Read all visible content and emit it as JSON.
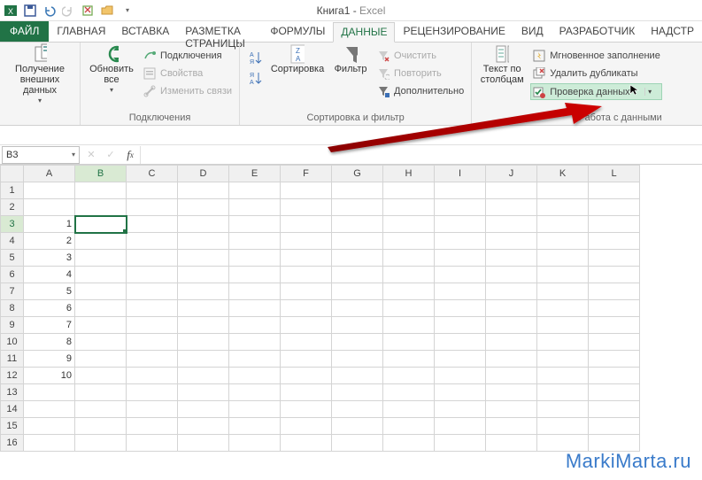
{
  "titlebar": {
    "doc": "Книга1",
    "app": "Excel"
  },
  "tabs": {
    "file": "ФАЙЛ",
    "items": [
      "ГЛАВНАЯ",
      "ВСТАВКА",
      "РАЗМЕТКА СТРАНИЦЫ",
      "ФОРМУЛЫ",
      "ДАННЫЕ",
      "РЕЦЕНЗИРОВАНИЕ",
      "ВИД",
      "РАЗРАБОТЧИК",
      "НАДСТР"
    ]
  },
  "ribbon": {
    "get_data": "Получение\nвнешних данных",
    "refresh": "Обновить\nвсе",
    "connections_group": "Подключения",
    "connections": "Подключения",
    "properties": "Свойства",
    "edit_links": "Изменить связи",
    "sort_asc": "А↓Я",
    "sort_desc": "Я↓А",
    "sort": "Сортировка",
    "filter": "Фильтр",
    "sortfilter_group": "Сортировка и фильтр",
    "clear": "Очистить",
    "reapply": "Повторить",
    "advanced": "Дополнительно",
    "text_to_columns": "Текст по\nстолбцам",
    "flash_fill": "Мгновенное заполнение",
    "remove_dup": "Удалить дубликаты",
    "data_validation": "Проверка данных",
    "data_tools_group": "Работа с данными"
  },
  "namebox": "B3",
  "columns": [
    "A",
    "B",
    "C",
    "D",
    "E",
    "F",
    "G",
    "H",
    "I",
    "J",
    "K",
    "L"
  ],
  "rows": [
    1,
    2,
    3,
    4,
    5,
    6,
    7,
    8,
    9,
    10,
    11,
    12,
    13,
    14,
    15,
    16
  ],
  "cells": {
    "A3": "1",
    "A4": "2",
    "A5": "3",
    "A6": "4",
    "A7": "5",
    "A8": "6",
    "A9": "7",
    "A10": "8",
    "A11": "9",
    "A12": "10"
  },
  "active_cell": "B3",
  "watermark": "MarkiMarta.ru"
}
